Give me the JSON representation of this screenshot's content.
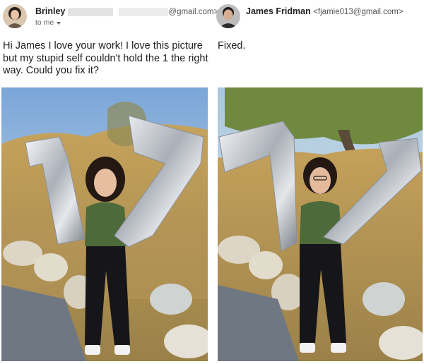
{
  "left_email": {
    "sender_name": "Brinley",
    "sender_email_suffix": "@gmail.com>",
    "to_label": "to me",
    "body": "Hi James I love your work! I love this picture but my stupid self couldn't hold the 1 the right way. Could you fix it?",
    "avatar_icon": "person-avatar-icon",
    "photo_icon": "woman-with-balloons-photo"
  },
  "right_email": {
    "sender_name": "James Fridman",
    "sender_email": "<fjamie013@gmail.com>",
    "body": "Fixed.",
    "avatar_icon": "person-avatar-icon",
    "photo_icon": "woman-with-balloons-photo"
  },
  "colors": {
    "text": "#202124",
    "muted": "#666666",
    "redaction": "#e3e3e3",
    "balloon_silver": "#c9ccd1"
  }
}
